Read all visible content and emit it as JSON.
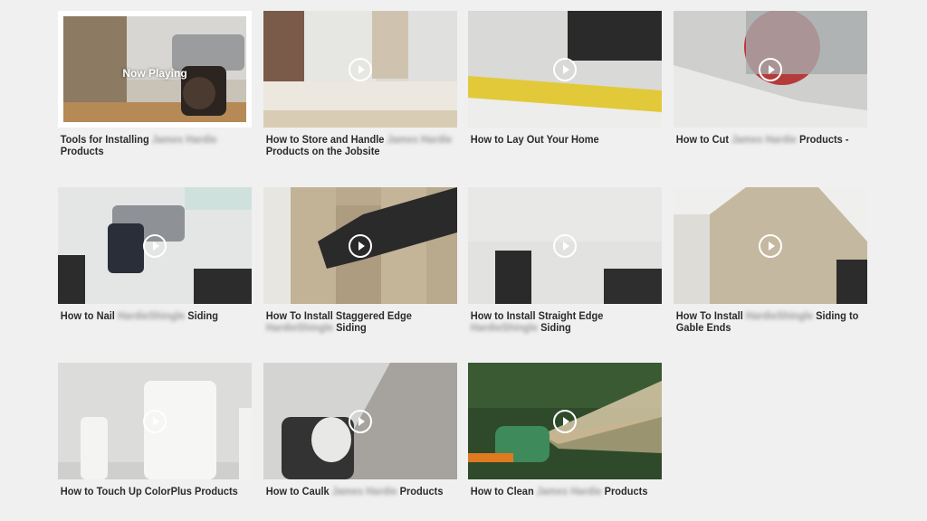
{
  "now_playing_label": "Now Playing",
  "brand_blur": "James Hardie",
  "product_blur": "HardieShingle",
  "videos": [
    {
      "pre": "Tools for Installing",
      "post": "Products",
      "blur": "brand"
    },
    {
      "pre": "How to Store and Handle",
      "post": "Products on the Jobsite",
      "blur": "brand"
    },
    {
      "pre": "How to Lay Out Your Home",
      "post": "",
      "blur": "none"
    },
    {
      "pre": "How to Cut",
      "post": "Products -",
      "blur": "brand"
    },
    {
      "pre": "How to Nail",
      "post": "Siding",
      "blur": "product"
    },
    {
      "pre": "How To Install Staggered Edge",
      "post": "Siding",
      "blur": "product"
    },
    {
      "pre": "How to Install Straight Edge",
      "post": "Siding",
      "blur": "product"
    },
    {
      "pre": "How To Install",
      "post": "Siding to Gable Ends",
      "blur": "product"
    },
    {
      "pre": "How to Touch Up ColorPlus Products",
      "post": "",
      "blur": "none"
    },
    {
      "pre": "How to Caulk",
      "post": "Products",
      "blur": "brand"
    },
    {
      "pre": "How to Clean",
      "post": "Products",
      "blur": "brand"
    }
  ]
}
